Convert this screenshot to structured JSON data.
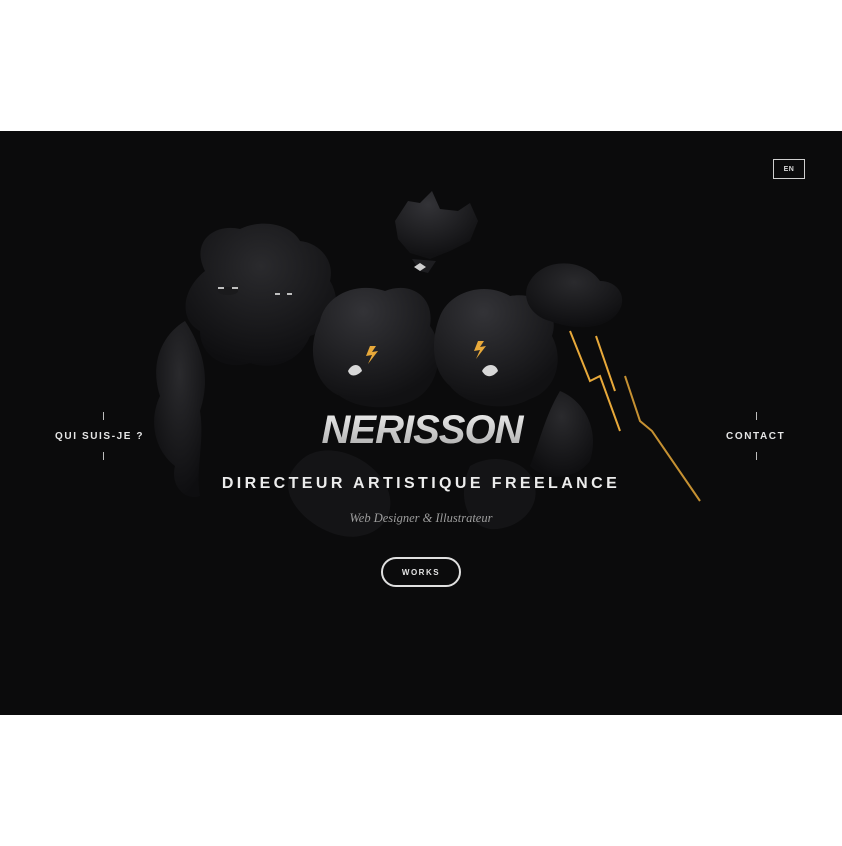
{
  "header": {
    "lang_label": "EN"
  },
  "nav": {
    "left_label": "QUI SUIS-JE ?",
    "right_label": "CONTACT"
  },
  "hero": {
    "logo_text": "NERISSON",
    "headline": "DIRECTEUR ARTISTIQUE FREELANCE",
    "subline": "Web Designer & Illustrateur",
    "cta_label": "WORKS"
  },
  "colors": {
    "background": "#0b0b0c",
    "accent_gold": "#e8a93a",
    "text": "#ececec"
  }
}
